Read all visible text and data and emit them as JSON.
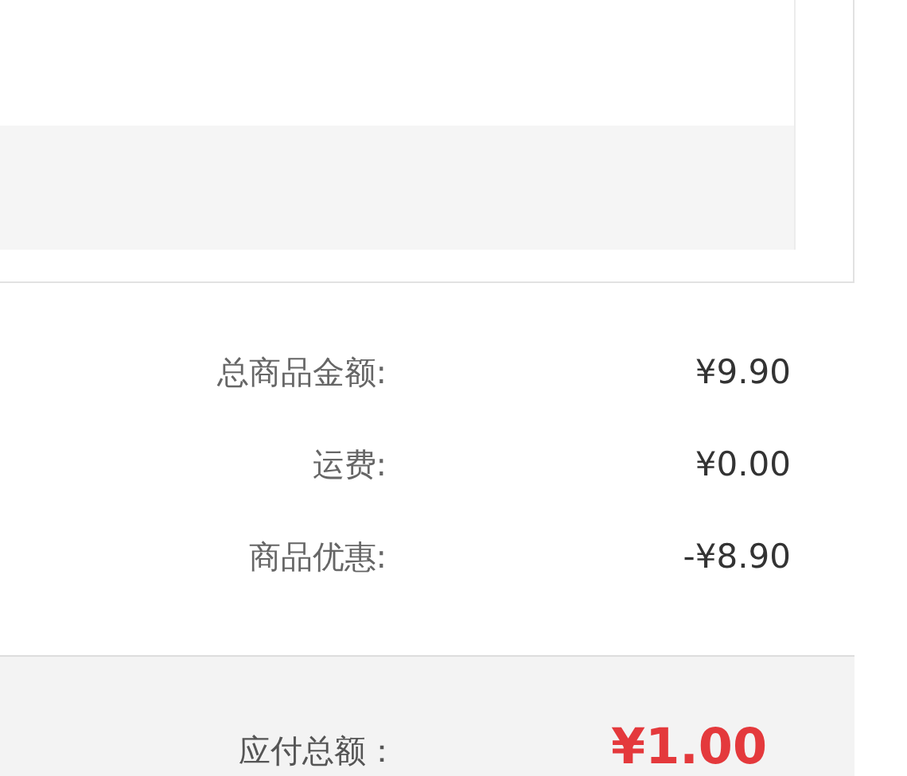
{
  "summary": [
    {
      "label": "总商品金额:",
      "value": "¥9.90"
    },
    {
      "label": "运费:",
      "value": "¥0.00"
    },
    {
      "label": "商品优惠:",
      "value": "-¥8.90"
    }
  ],
  "total": {
    "label": "应付总额：",
    "value": "¥1.00"
  }
}
